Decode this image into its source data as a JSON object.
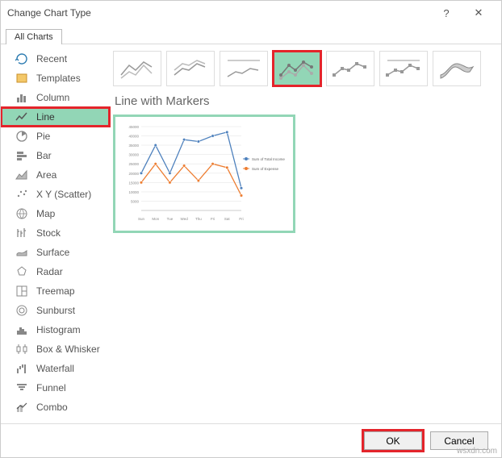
{
  "titlebar": {
    "title": "Change Chart Type",
    "help": "?",
    "close": "✕"
  },
  "tabs": {
    "all": "All Charts"
  },
  "sidebar": {
    "items": [
      {
        "label": "Recent"
      },
      {
        "label": "Templates"
      },
      {
        "label": "Column"
      },
      {
        "label": "Line"
      },
      {
        "label": "Pie"
      },
      {
        "label": "Bar"
      },
      {
        "label": "Area"
      },
      {
        "label": "X Y (Scatter)"
      },
      {
        "label": "Map"
      },
      {
        "label": "Stock"
      },
      {
        "label": "Surface"
      },
      {
        "label": "Radar"
      },
      {
        "label": "Treemap"
      },
      {
        "label": "Sunburst"
      },
      {
        "label": "Histogram"
      },
      {
        "label": "Box & Whisker"
      },
      {
        "label": "Waterfall"
      },
      {
        "label": "Funnel"
      },
      {
        "label": "Combo"
      }
    ]
  },
  "main": {
    "subtype_title": "Line with Markers"
  },
  "chart_data": {
    "type": "line",
    "categories": [
      "Sun",
      "Mon",
      "Tue",
      "Wed",
      "Thu",
      "Fri",
      "Sat",
      "Fri"
    ],
    "series": [
      {
        "name": "Sum of Total Income",
        "color": "#4e81bd",
        "values": [
          20000,
          35000,
          20000,
          38000,
          37000,
          40000,
          42000,
          12000
        ]
      },
      {
        "name": "Sum of Expense",
        "color": "#ed7d31",
        "values": [
          15000,
          25000,
          15000,
          24000,
          16000,
          25000,
          23000,
          8000
        ]
      }
    ],
    "ylim": [
      0,
      45000
    ],
    "ylabel": "",
    "xlabel": "",
    "y_ticks": [
      5000,
      10000,
      15000,
      20000,
      25000,
      30000,
      35000,
      40000,
      45000
    ]
  },
  "footer": {
    "ok": "OK",
    "cancel": "Cancel"
  },
  "watermark": "wsxdn.com"
}
